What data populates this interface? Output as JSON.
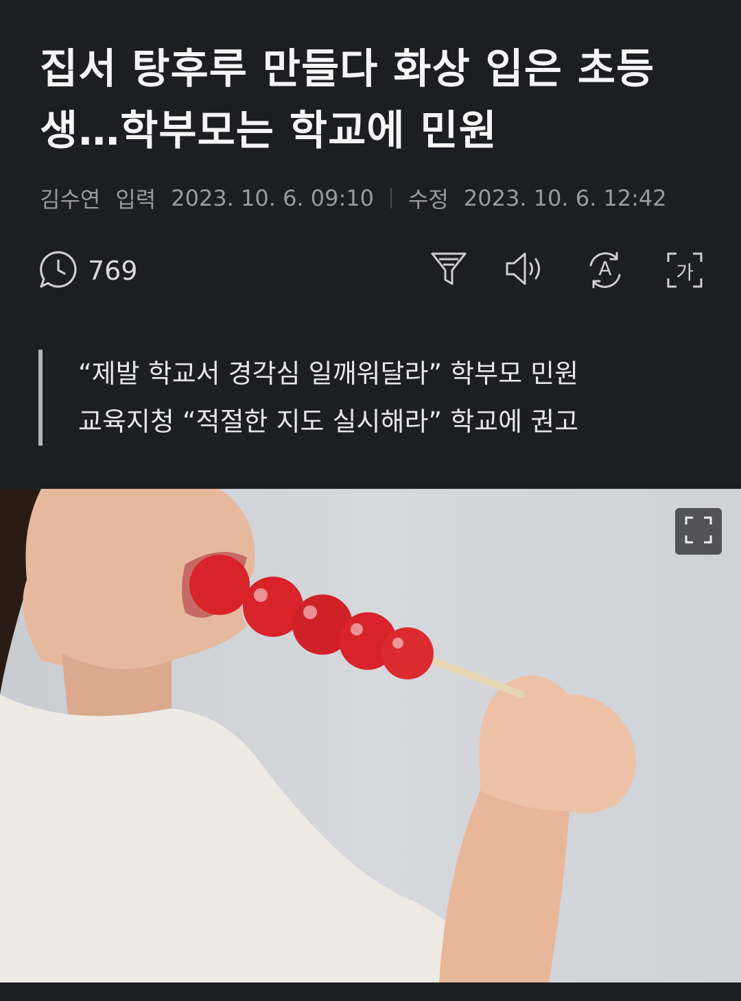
{
  "article": {
    "title_line1": "집서 탕후루 만들다 화상 입은 초등",
    "title_line2": "생…학부모는 학교에 민원",
    "author": "김수연",
    "input_label": "입력",
    "input_time": "2023. 10. 6. 09:10",
    "edit_label": "수정",
    "edit_time": "2023. 10. 6. 12:42",
    "comment_count": "769",
    "font_size_glyph": "가",
    "translate_glyph": "A",
    "summary_line1": "“제발 학교서 경각심 일깨워달라” 학부모 민원",
    "summary_line2": "교육지청 “적절한 지도 실시해라” 학교에 권고"
  },
  "icons": {
    "comment": "comment-icon",
    "filter": "filter-icon",
    "speaker": "speaker-icon",
    "translate": "translate-icon",
    "font_size": "font-size-icon",
    "expand": "expand-icon"
  },
  "colors": {
    "background": "#1d1e22",
    "title": "#f5f5f5",
    "meta": "#9a9ba0",
    "strawberry": "#d8232a"
  }
}
